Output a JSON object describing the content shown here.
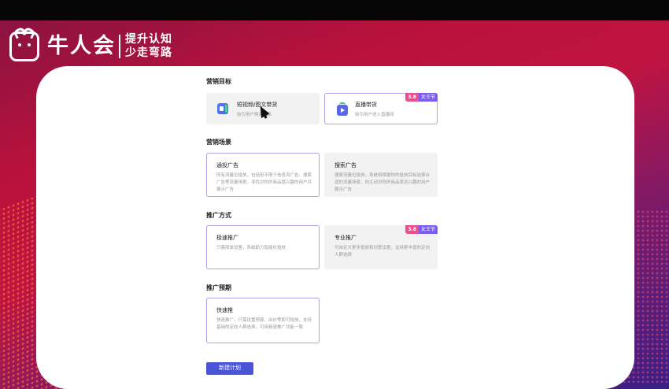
{
  "brand": {
    "name": "牛人会",
    "slogan_line1": "提升认知",
    "slogan_line2": "少走弯路"
  },
  "sections": {
    "goal": {
      "title": "营销目标",
      "cards": [
        {
          "title": "短视频/图文带货",
          "desc": "吸引用户购买商品",
          "icon": "video-icon",
          "selected": false
        },
        {
          "title": "直播带货",
          "desc": "吸引用户进入直播间",
          "icon": "live-icon",
          "selected": true,
          "badge": {
            "num": "3.8",
            "text": "女王节"
          }
        }
      ]
    },
    "scene": {
      "title": "营销场景",
      "cards": [
        {
          "title": "通投广告",
          "desc": "所有流量位投放，包括但不限于信息流广告、搜索广告等流量场景，寻找对你的商品感兴趣的用户并展示广告",
          "selected": true
        },
        {
          "title": "搜索广告",
          "desc": "搜索流量位投放，系统将根据你的投放目标选择合适的流量场景，向主动对你的商品表达兴趣的用户展示广告",
          "selected": false
        }
      ]
    },
    "method": {
      "title": "推广方式",
      "cards": [
        {
          "title": "极速推广",
          "desc": "只需简单设置，系统助力智能化投放",
          "selected": true
        },
        {
          "title": "专业推广",
          "desc": "可自定义更多投放和创意设置，支持更丰富的定向人群选择",
          "selected": false,
          "badge": {
            "num": "3.8",
            "text": "女王节"
          }
        }
      ]
    },
    "budget": {
      "title": "推广预期",
      "cards": [
        {
          "title": "快速推",
          "desc": "快速推广，只需设置预算、出价等即可投放，支持基础的定向人群选择，可用极速推广功能一致",
          "selected": true
        }
      ]
    }
  },
  "actions": {
    "create_label": "新建计划"
  },
  "colors": {
    "accent": "#4a55d6",
    "selected_border": "#aaa6e6",
    "badge_pink": "#e94f8c",
    "badge_purple": "#7c5cf0"
  }
}
